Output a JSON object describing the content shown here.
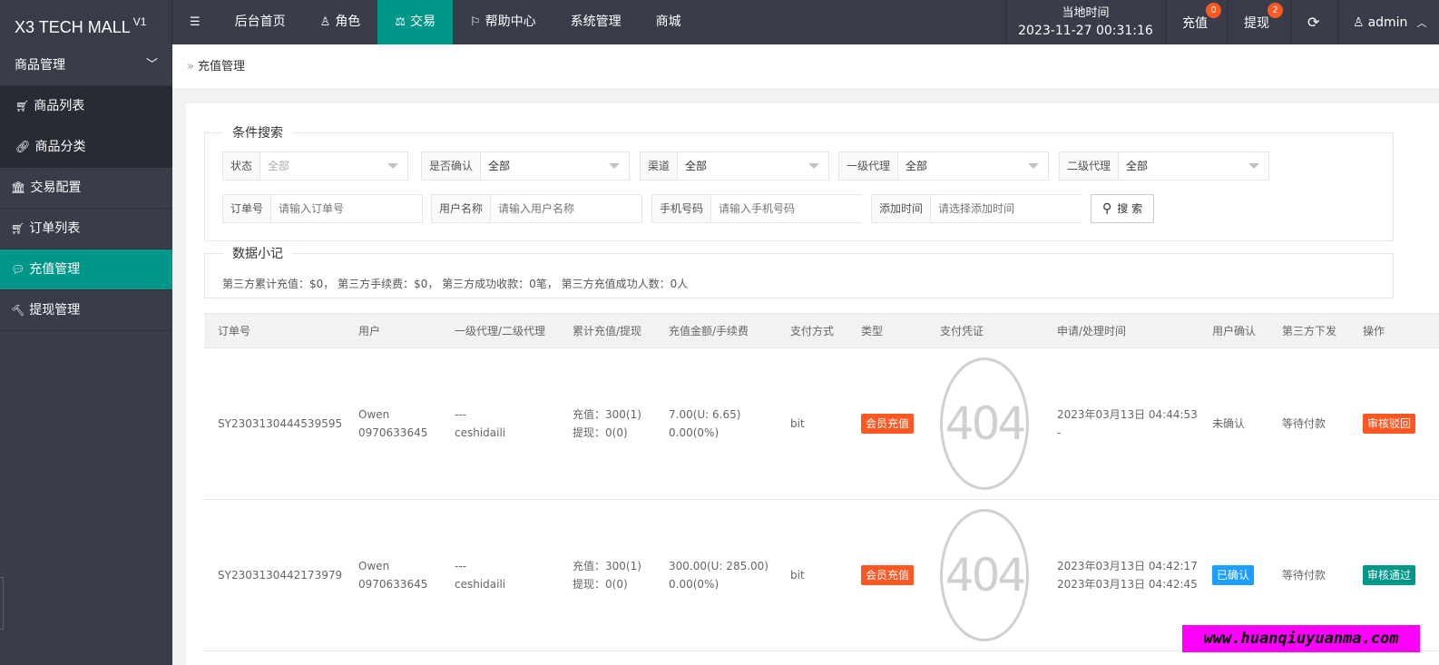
{
  "brand": {
    "title": "X3 TECH MALL",
    "version": "V1"
  },
  "topnav": {
    "menu_icon": "hamburger-icon",
    "items": [
      {
        "label": "后台首页",
        "icon": ""
      },
      {
        "label": "角色",
        "icon": "user-icon"
      },
      {
        "label": "交易",
        "icon": "scale-icon"
      },
      {
        "label": "帮助中心",
        "icon": "flag-icon"
      },
      {
        "label": "系统管理",
        "icon": ""
      },
      {
        "label": "商城",
        "icon": ""
      }
    ],
    "active_index": 2
  },
  "header_right": {
    "time_label": "当地时间",
    "time_value": "2023-11-27 00:31:16",
    "recharge_label": "充值",
    "recharge_badge": "0",
    "withdraw_label": "提现",
    "withdraw_badge": "2",
    "user": "admin"
  },
  "sidebar": {
    "group_label": "商品管理",
    "sub_items": [
      "商品列表",
      "商品分类"
    ],
    "items": [
      "交易配置",
      "订单列表",
      "充值管理",
      "提现管理"
    ],
    "active_label": "充值管理"
  },
  "breadcrumb": {
    "current": "充值管理"
  },
  "search": {
    "legend": "条件搜索",
    "status": {
      "label": "状态",
      "value": "全部"
    },
    "confirm": {
      "label": "是否确认",
      "value": "全部"
    },
    "channel": {
      "label": "渠道",
      "value": "全部"
    },
    "agent1": {
      "label": "一级代理",
      "value": "全部"
    },
    "agent2": {
      "label": "二级代理",
      "value": "全部"
    },
    "order_no": {
      "label": "订单号",
      "placeholder": "请输入订单号"
    },
    "username": {
      "label": "用户名称",
      "placeholder": "请输入用户名称"
    },
    "phone": {
      "label": "手机号码",
      "placeholder": "请输入手机号码"
    },
    "add_time": {
      "label": "添加时间",
      "placeholder": "请选择添加时间"
    },
    "button": "搜 索"
  },
  "summary": {
    "legend": "数据小记",
    "text": "第三方累计充值：$0， 第三方手续费：$0， 第三方成功收款：0笔， 第三方充值成功人数：0人"
  },
  "table": {
    "headers": [
      "订单号",
      "用户",
      "一级代理/二级代理",
      "累计充值/提现",
      "充值金额/手续费",
      "支付方式",
      "类型",
      "支付凭证",
      "申请/处理时间",
      "用户确认",
      "第三方下发",
      "操作"
    ],
    "rows": [
      {
        "order_no": "SY2303130444539595",
        "user_name": "Owen",
        "user_phone": "0970633645",
        "agent1": "---",
        "agent2": "ceshidaili",
        "recharge_total": "充值：300(1)",
        "withdraw_total": "提现：0(0)",
        "amount": "7.00(U: 6.65)",
        "fee": "0.00(0%)",
        "pay_method": "bit",
        "type": "会员充值",
        "voucher": "404",
        "apply_time": "2023年03月13日 04:44:53",
        "process_time": "-",
        "user_confirm": "未确认",
        "third_party": "等待付款",
        "action": "审核驳回",
        "confirm_color": "none",
        "action_color": "#ff5722"
      },
      {
        "order_no": "SY2303130442173979",
        "user_name": "Owen",
        "user_phone": "0970633645",
        "agent1": "---",
        "agent2": "ceshidaili",
        "recharge_total": "充值：300(1)",
        "withdraw_total": "提现：0(0)",
        "amount": "300.00(U: 285.00)",
        "fee": "0.00(0%)",
        "pay_method": "bit",
        "type": "会员充值",
        "voucher": "404",
        "apply_time": "2023年03月13日 04:42:17",
        "process_time": "2023年03月13日 04:42:45",
        "user_confirm": "已确认",
        "third_party": "等待付款",
        "action": "审核通过",
        "confirm_color": "#1e9fff",
        "action_color": "#009688"
      }
    ]
  },
  "watermark": "www.huanqiuyuanma.com"
}
